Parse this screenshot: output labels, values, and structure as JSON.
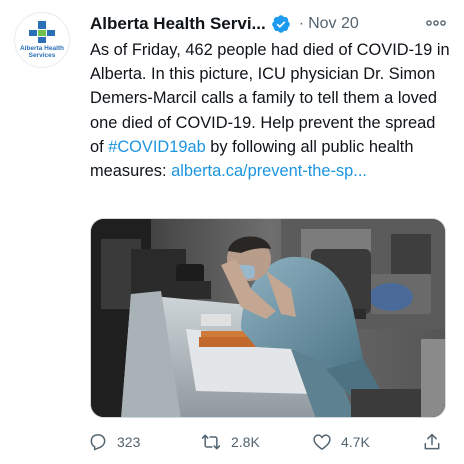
{
  "tweet": {
    "author_name": "Alberta Health Servi...",
    "separator": "·",
    "date": "Nov 20",
    "avatar_text_line1": "Alberta Health",
    "avatar_text_line2": "Services",
    "text_main": "As of Friday, 462 people had died of COVID-19 in Alberta. In this picture, ICU physician Dr. Simon Demers-Marcil calls a family to tell them a loved one died of COVID-19. Help prevent the spread of ",
    "hashtag": "#COVID19ab",
    "text_after_hashtag": " by following all public health measures: ",
    "link": "alberta.ca/prevent-the-sp...",
    "media_icon": "photo-icu-physician-on-phone",
    "actions": {
      "reply_count": "323",
      "retweet_count": "2.8K",
      "like_count": "4.7K"
    }
  },
  "icons": {
    "verified": "verified-badge-icon",
    "more": "more-options-icon",
    "reply": "reply-icon",
    "retweet": "retweet-icon",
    "like": "heart-icon",
    "share": "share-icon"
  },
  "colors": {
    "link": "#1b95e0",
    "verified": "#1d9bf0",
    "muted": "#536471",
    "brand_blue": "#2b6fb6",
    "brand_green": "#6cc24a"
  }
}
